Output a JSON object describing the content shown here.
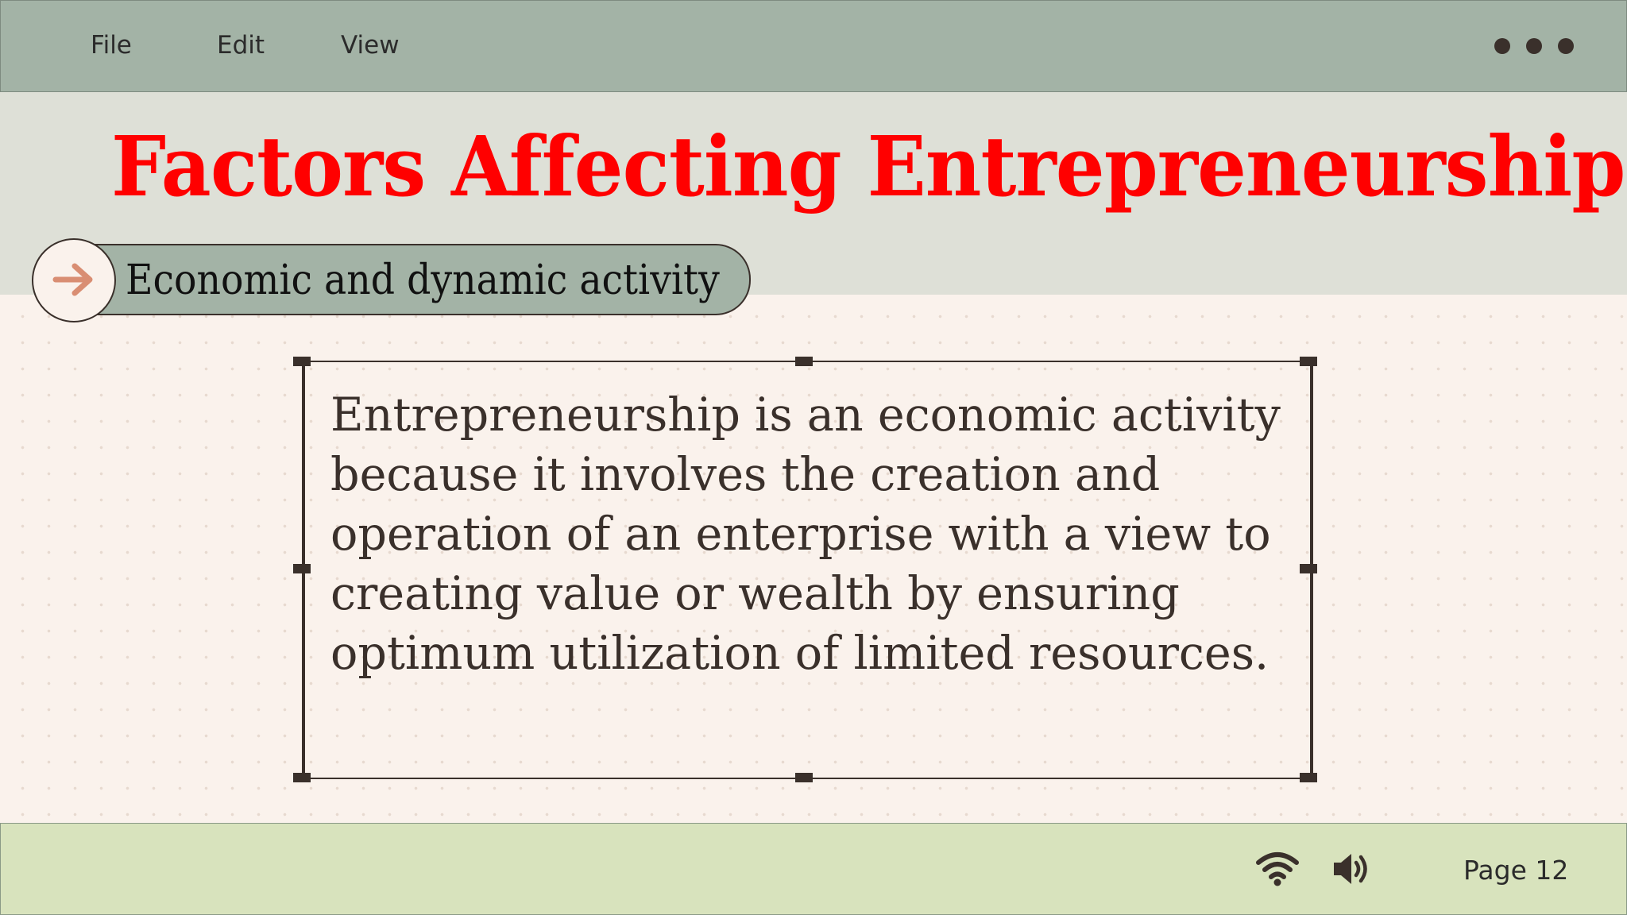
{
  "menubar": {
    "items": [
      "File",
      "Edit",
      "View"
    ]
  },
  "slide": {
    "title": "Factors Affecting Entrepreneurship",
    "section_label": "Economic and dynamic activity",
    "body_text": "Entrepreneurship is an economic activity because it involves the creation and operation of an enterprise with a view to creating value or wealth by ensuring optimum utilization of limited resources."
  },
  "statusbar": {
    "page_label": "Page 12"
  },
  "icons": {
    "more": "more-dots-icon",
    "arrow": "arrow-right-icon",
    "wifi": "wifi-icon",
    "volume": "volume-icon"
  },
  "colors": {
    "title": "#ff0000",
    "menubar": "#a3b3a6",
    "statusbar": "#d8e3bd",
    "arrow": "#d98e73"
  }
}
